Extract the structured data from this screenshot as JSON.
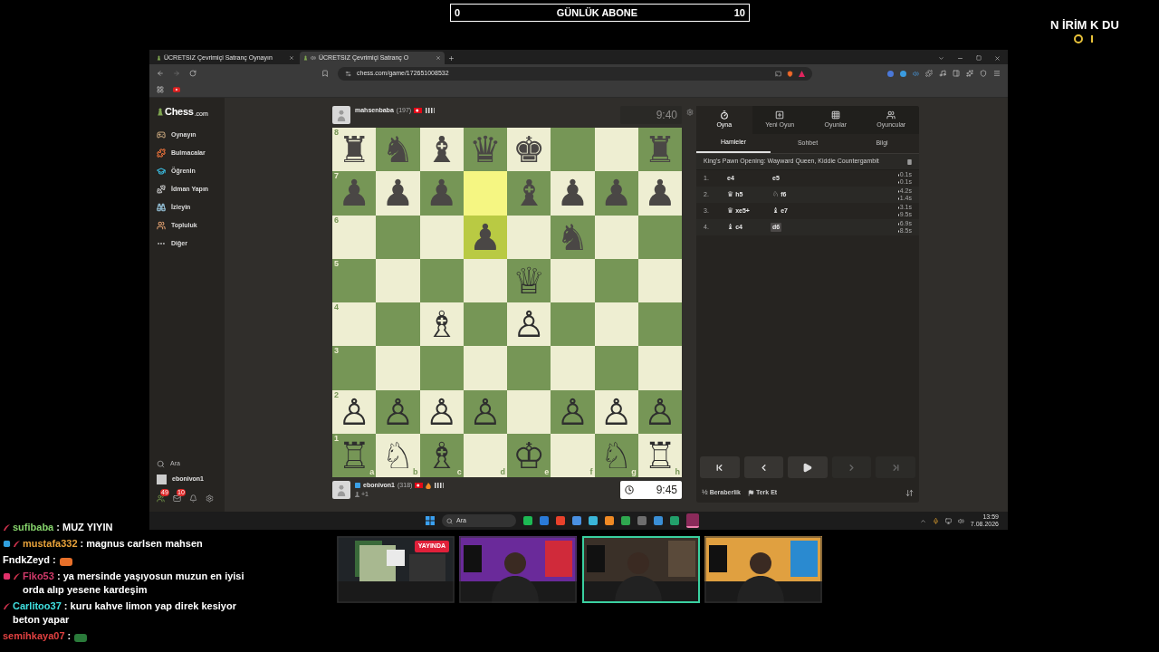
{
  "goal_bar": {
    "current": "0",
    "label": "GÜNLÜK ABONE",
    "target": "10"
  },
  "brand": {
    "text": "N İRİM K DU"
  },
  "browser": {
    "tabs": [
      {
        "title": "ÜCRETSIZ Çevrimiçi Satranç Oynayın",
        "selected": false
      },
      {
        "title": "ÜCRETSIZ Çevrimiçi Satranç O",
        "selected": true
      }
    ],
    "url": "chess.com/game/172651008532"
  },
  "sidebar": {
    "logo_main": "Chess",
    "logo_suffix": ".com",
    "items": [
      {
        "label": "Oynayın",
        "kind": "play"
      },
      {
        "label": "Bulmacalar",
        "kind": "puzzle"
      },
      {
        "label": "Öğrenin",
        "kind": "learn"
      },
      {
        "label": "İdman Yapın",
        "kind": "train"
      },
      {
        "label": "İzleyin",
        "kind": "watch"
      },
      {
        "label": "Topluluk",
        "kind": "community"
      },
      {
        "label": "Diğer",
        "kind": "more"
      }
    ],
    "search": "Ara",
    "user": "ebonivon1",
    "badges": [
      "49",
      "10"
    ]
  },
  "players": [
    {
      "name": "mahsenbaba",
      "rating": "(197)",
      "clock": "9:40",
      "active": false
    },
    {
      "name": "ebonivon1",
      "rating": "(318)",
      "clock": "9:45",
      "active": true,
      "captured": "+1"
    }
  ],
  "board": {
    "files": [
      "a",
      "b",
      "c",
      "d",
      "e",
      "f",
      "g",
      "h"
    ],
    "ranks": [
      {
        "label": "8",
        "squares": [
          {
            "piece": "♜",
            "kind": "black",
            "highlighted": false
          },
          {
            "piece": "♞",
            "kind": "black",
            "highlighted": false
          },
          {
            "piece": "♝",
            "kind": "black",
            "highlighted": false
          },
          {
            "piece": "♛",
            "kind": "black",
            "highlighted": false
          },
          {
            "piece": "♚",
            "kind": "black",
            "highlighted": false
          },
          {
            "highlighted": false
          },
          {
            "highlighted": false
          },
          {
            "piece": "♜",
            "kind": "black",
            "highlighted": false
          }
        ]
      },
      {
        "label": "7",
        "squares": [
          {
            "piece": "♟",
            "kind": "black",
            "highlighted": false
          },
          {
            "piece": "♟",
            "kind": "black",
            "highlighted": false
          },
          {
            "piece": "♟",
            "kind": "black",
            "highlighted": false
          },
          {
            "highlighted": true
          },
          {
            "piece": "♝",
            "kind": "black",
            "highlighted": false
          },
          {
            "piece": "♟",
            "kind": "black",
            "highlighted": false
          },
          {
            "piece": "♟",
            "kind": "black",
            "highlighted": false
          },
          {
            "piece": "♟",
            "kind": "black",
            "highlighted": false
          }
        ]
      },
      {
        "label": "6",
        "squares": [
          {
            "highlighted": false
          },
          {
            "highlighted": false
          },
          {
            "highlighted": false
          },
          {
            "piece": "♟",
            "kind": "black",
            "highlighted": true
          },
          {
            "highlighted": false
          },
          {
            "piece": "♞",
            "kind": "black",
            "highlighted": false
          },
          {
            "highlighted": false
          },
          {
            "highlighted": false
          }
        ]
      },
      {
        "label": "5",
        "squares": [
          {
            "highlighted": false
          },
          {
            "highlighted": false
          },
          {
            "highlighted": false
          },
          {
            "highlighted": false
          },
          {
            "piece": "♕",
            "kind": "white",
            "highlighted": false
          },
          {
            "highlighted": false
          },
          {
            "highlighted": false
          },
          {
            "highlighted": false
          }
        ]
      },
      {
        "label": "4",
        "squares": [
          {
            "highlighted": false
          },
          {
            "highlighted": false
          },
          {
            "piece": "♗",
            "kind": "white",
            "highlighted": false
          },
          {
            "highlighted": false
          },
          {
            "piece": "♙",
            "kind": "white",
            "highlighted": false
          },
          {
            "highlighted": false
          },
          {
            "highlighted": false
          },
          {
            "highlighted": false
          }
        ]
      },
      {
        "label": "3",
        "squares": [
          {
            "highlighted": false
          },
          {
            "highlighted": false
          },
          {
            "highlighted": false
          },
          {
            "highlighted": false
          },
          {
            "highlighted": false
          },
          {
            "highlighted": false
          },
          {
            "highlighted": false
          },
          {
            "highlighted": false
          }
        ]
      },
      {
        "label": "2",
        "squares": [
          {
            "piece": "♙",
            "kind": "white",
            "highlighted": false
          },
          {
            "piece": "♙",
            "kind": "white",
            "highlighted": false
          },
          {
            "piece": "♙",
            "kind": "white",
            "highlighted": false
          },
          {
            "piece": "♙",
            "kind": "white",
            "highlighted": false
          },
          {
            "highlighted": false
          },
          {
            "piece": "♙",
            "kind": "white",
            "highlighted": false
          },
          {
            "piece": "♙",
            "kind": "white",
            "highlighted": false
          },
          {
            "piece": "♙",
            "kind": "white",
            "highlighted": false
          }
        ]
      },
      {
        "label": "1",
        "squares": [
          {
            "piece": "♖",
            "kind": "white",
            "highlighted": false
          },
          {
            "piece": "♘",
            "kind": "white",
            "highlighted": false
          },
          {
            "piece": "♗",
            "kind": "white",
            "highlighted": false
          },
          {
            "highlighted": false
          },
          {
            "piece": "♔",
            "kind": "white",
            "highlighted": false
          },
          {
            "highlighted": false
          },
          {
            "piece": "♘",
            "kind": "white",
            "highlighted": false
          },
          {
            "piece": "♖",
            "kind": "white",
            "highlighted": false
          }
        ]
      }
    ]
  },
  "panel": {
    "top_tabs": [
      {
        "label": "Oyna",
        "selected": true,
        "kind": "play"
      },
      {
        "label": "Yeni Oyun",
        "selected": false,
        "kind": "new"
      },
      {
        "label": "Oyunlar",
        "selected": false,
        "kind": "games"
      },
      {
        "label": "Oyuncular",
        "selected": false,
        "kind": "players"
      }
    ],
    "sub_tabs": [
      {
        "label": "Hamleler",
        "selected": true
      },
      {
        "label": "Sohbet",
        "selected": false
      },
      {
        "label": "Bilgi",
        "selected": false
      }
    ],
    "opening": "King's Pawn Opening: Wayward Queen, Kiddie Countergambit",
    "moves": [
      {
        "number": "1.",
        "white": {
          "san": "e4",
          "selected": false
        },
        "black": {
          "san": "e5",
          "selected": false
        },
        "times": [
          "0.1s",
          "0.1s"
        ]
      },
      {
        "number": "2.",
        "white": {
          "figure": "♛",
          "san": "h5",
          "selected": false
        },
        "black": {
          "figure": "♘",
          "san": "f6",
          "selected": false
        },
        "times": [
          "4.2s",
          "1.4s"
        ]
      },
      {
        "number": "3.",
        "white": {
          "figure": "♛",
          "san": "xe5+",
          "selected": false
        },
        "black": {
          "figure": "♝",
          "san": "e7",
          "selected": false
        },
        "times": [
          "3.1s",
          "9.5s"
        ]
      },
      {
        "number": "4.",
        "white": {
          "figure": "♝",
          "san": "c4",
          "selected": false
        },
        "black": {
          "san": "d6",
          "selected": true
        },
        "times": [
          "6.9s",
          "8.5s"
        ]
      }
    ],
    "nav": [
      {
        "kind": "first",
        "disabled": false
      },
      {
        "kind": "prev",
        "disabled": false
      },
      {
        "kind": "play",
        "disabled": false
      },
      {
        "kind": "next",
        "disabled": true
      },
      {
        "kind": "last",
        "disabled": true
      }
    ],
    "draw_symbol": "½",
    "draw": "Beraberlik",
    "resign": "Terk Et"
  },
  "taskbar": {
    "search": "Ara",
    "time": "13:59",
    "date": "7.08.2026"
  },
  "cams": [
    {
      "kind": "picture",
      "badge": "YAYINDA",
      "highlighted": false
    },
    {
      "kind": "picture",
      "highlighted": false
    },
    {
      "kind": "picture",
      "highlighted": true
    },
    {
      "kind": "picture",
      "highlighted": false
    }
  ],
  "chat": [
    {
      "badges": [
        {
          "kind": "feather"
        }
      ],
      "user": "sufibaba",
      "color": "#86d46c",
      "text": ": MUZ YIYIN"
    },
    {
      "badges": [
        {
          "kind": "cube"
        },
        {
          "kind": "feather"
        }
      ],
      "user": "mustafa332",
      "color": "#e8a23a",
      "text": ": magnus carlsen mahsen"
    },
    {
      "user": "FndkZeyd",
      "color": "#ffffff",
      "text": ":",
      "emote": true
    },
    {
      "badges": [
        {
          "kind": "gift"
        },
        {
          "kind": "feather"
        }
      ],
      "user": "Fiko53",
      "color": "#d13a6a",
      "text": ": ya mersinde yaşıyosun muzun en iyisi orda alıp yesene kardeşim"
    },
    {
      "badges": [
        {
          "kind": "feather"
        }
      ],
      "user": "Carlitoo37",
      "color": "#40e0e0",
      "text": ": kuru kahve limon yap direk kesiyor beton yapar"
    },
    {
      "user": "semihkaya07",
      "color": "#e04040",
      "text": ":",
      "emote": true
    }
  ]
}
